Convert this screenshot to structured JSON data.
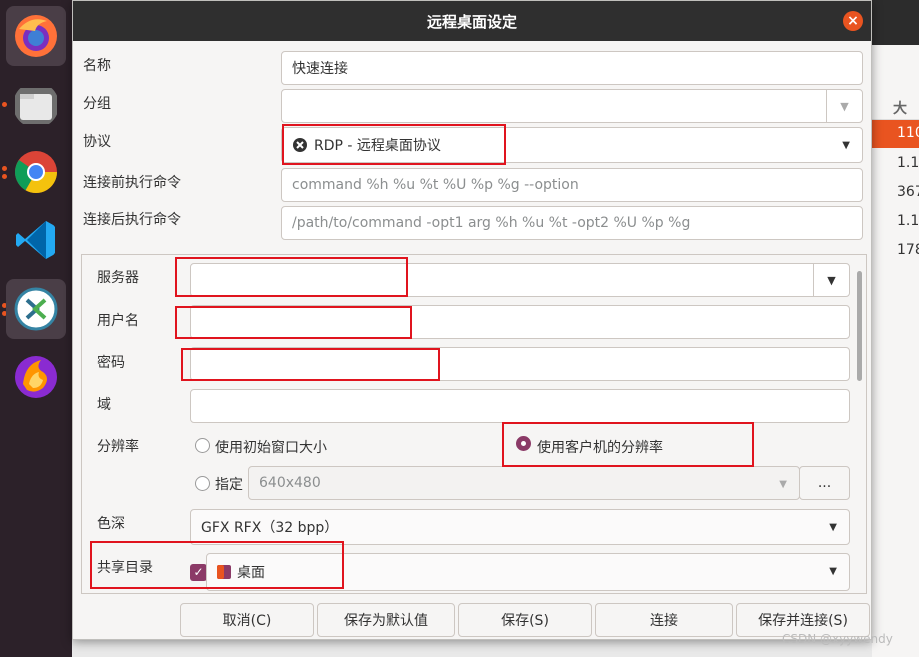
{
  "dialog": {
    "title": "远程桌面设定",
    "close_icon": "×"
  },
  "form": {
    "name_label": "名称",
    "name_value": "快速连接",
    "group_label": "分组",
    "group_value": "",
    "protocol_label": "协议",
    "protocol_value": "RDP - 远程桌面协议",
    "pre_cmd_label": "连接前执行命令",
    "pre_cmd_placeholder": "command %h %u %t %U %p %g --option",
    "post_cmd_label": "连接后执行命令",
    "post_cmd_placeholder": "/path/to/command -opt1 arg %h %u %t -opt2 %U %p %g"
  },
  "panel": {
    "server_label": "服务器",
    "username_label": "用户名",
    "password_label": "密码",
    "domain_label": "域",
    "resolution_label": "分辨率",
    "res_opt_initial": "使用初始窗口大小",
    "res_opt_client": "使用客户机的分辨率",
    "res_opt_custom": "指定",
    "res_custom_value": "640x480",
    "res_more": "...",
    "color_depth_label": "色深",
    "color_depth_value": "GFX RFX（32 bpp）",
    "shared_dir_label": "共享目录",
    "shared_dir_value": "桌面"
  },
  "buttons": {
    "cancel": "取消(C)",
    "save_default": "保存为默认值",
    "save": "保存(S)",
    "connect": "连接",
    "save_connect": "保存并连接(S)"
  },
  "background": {
    "col_header": "大小",
    "rows": [
      "110",
      "1.1",
      "367",
      "1.1",
      "178"
    ]
  },
  "watermark": "CSDN @xyywendy",
  "colors": {
    "accent": "#e95420",
    "radio_checked": "#8b3a67",
    "annotation": "#e0141e"
  }
}
